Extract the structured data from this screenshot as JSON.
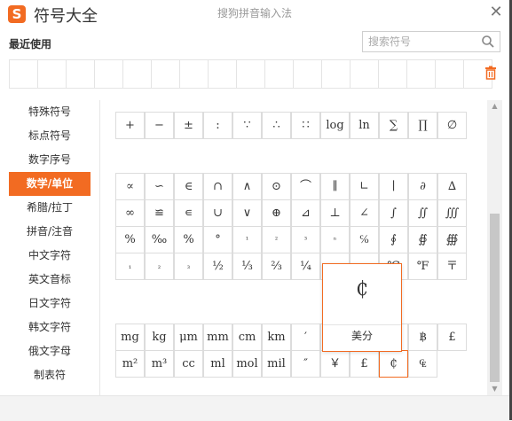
{
  "titlebar": {
    "logo": "S",
    "app_title": "符号大全",
    "window_title": "搜狗拼音输入法",
    "close": "✕"
  },
  "recent": {
    "label": "最近使用",
    "slots": 17
  },
  "search": {
    "placeholder": "搜索符号"
  },
  "nav": [
    "特殊符号",
    "标点符号",
    "数字序号",
    "数学/单位",
    "希腊/拉丁",
    "拼音/注音",
    "中文字符",
    "英文音标",
    "日文字符",
    "韩文字符",
    "俄文字母",
    "制表符"
  ],
  "nav_active": "数学/单位",
  "groups": {
    "math_ops_partial": [
      "+",
      "−",
      "±",
      ":",
      "∵",
      "∴",
      "∷",
      "log",
      "ln",
      "∑",
      "∏",
      "∅"
    ],
    "math_rows": [
      [
        "∝",
        "∽",
        "∈",
        "∩",
        "∧",
        "⊙",
        "⌒",
        "∥",
        "∟",
        "∣",
        "∂",
        "∆"
      ],
      [
        "∞",
        "≌",
        "∊",
        "∪",
        "∨",
        "⊕",
        "⊿",
        "⊥",
        "∠",
        "∫",
        "∬",
        "∭"
      ],
      [
        "%",
        "‰",
        "%",
        "°",
        "¹",
        "²",
        "³",
        "ⁿ",
        "℅",
        "∮",
        "∯",
        "∰"
      ],
      [
        "₁",
        "₂",
        "₃",
        "½",
        "⅓",
        "⅔",
        "¼",
        "",
        "",
        "℃",
        "℉",
        "〒"
      ]
    ],
    "unit_rows": [
      [
        "mg",
        "kg",
        "μm",
        "mm",
        "cm",
        "km",
        "′",
        "",
        "",
        "¢",
        "฿",
        "£"
      ],
      [
        "m²",
        "m³",
        "cc",
        "ml",
        "mol",
        "mil",
        "″",
        "￥",
        "£",
        "₵",
        "₠"
      ]
    ]
  },
  "popup": {
    "symbol": "₵",
    "name": "美分"
  }
}
